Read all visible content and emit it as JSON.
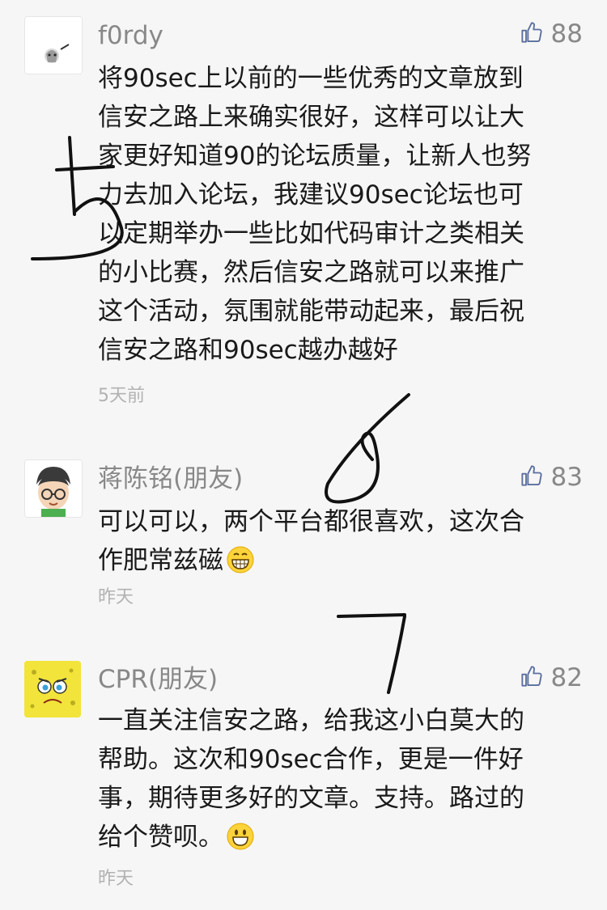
{
  "comments": [
    {
      "name": "f0rdy",
      "likes": "88",
      "lines": [
        "将90sec上以前的一些优秀的文章放到",
        "信安之路上来确实很好，这样可以让大",
        "家更好知道90的论坛质量，让新人也努",
        "力去加入论坛，我建议90sec论坛也可",
        "以定期举办一些比如代码审计之类相关",
        "的小比赛，然后信安之路就可以来推广",
        "这个活动，氛围就能带动起来，最后祝",
        "信安之路和90sec越办越好"
      ],
      "time": "5天前"
    },
    {
      "name": "蒋陈铭(朋友)",
      "likes": "83",
      "lines": [
        "可以可以，两个平台都很喜欢，这次合",
        "作肥常兹磁"
      ],
      "time": "昨天"
    },
    {
      "name": "CPR(朋友)",
      "likes": "82",
      "lines": [
        "一直关注信安之路，给我这小白莫大的",
        "帮助。这次和90sec合作，更是一件好",
        "事，期待更多好的文章。支持。路过的",
        "给个赞呗。"
      ],
      "time": "昨天"
    }
  ],
  "icons": {
    "like": "thumbs-up-icon",
    "emoji_grin": "grinning-emoji-icon",
    "emoji_smile": "smiling-emoji-icon"
  },
  "colors": {
    "like_icon": "#5b6f9e",
    "handwriting": "#111111"
  }
}
